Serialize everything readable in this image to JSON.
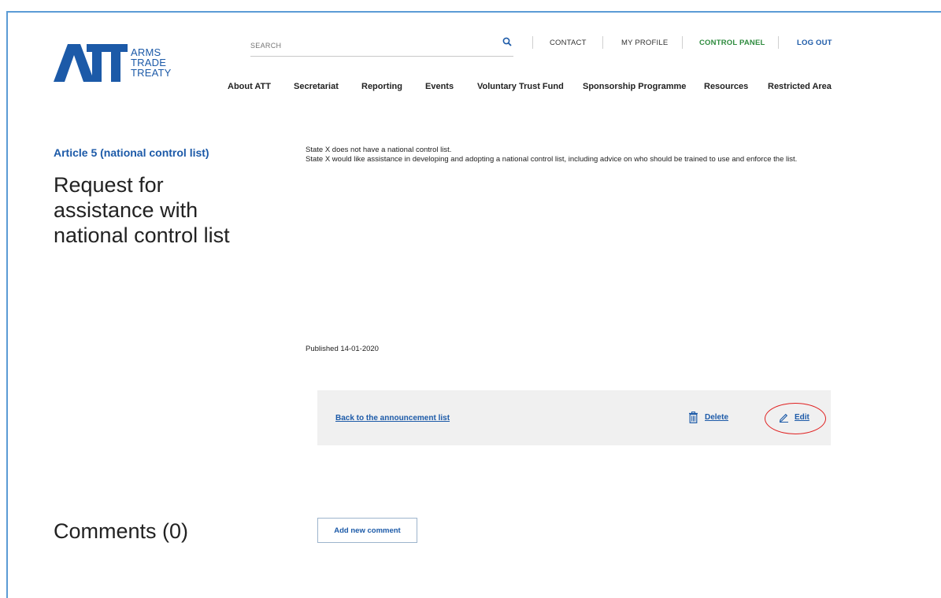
{
  "logo": {
    "mark": "ATT",
    "words": [
      "ARMS",
      "TRADE",
      "TREATY"
    ]
  },
  "search": {
    "placeholder": "SEARCH"
  },
  "utility_nav": {
    "contact": "CONTACT",
    "my_profile": "MY PROFILE",
    "control_panel": "CONTROL PANEL",
    "log_out": "LOG OUT"
  },
  "main_nav": [
    "About ATT",
    "Secretariat",
    "Reporting",
    "Events",
    "Voluntary Trust Fund",
    "Sponsorship Programme",
    "Resources",
    "Restricted Area"
  ],
  "announcement": {
    "category": "Article 5 (national control list)",
    "title": "Request for assistance with national control list",
    "body": [
      "State X does not have a national control list.",
      "State X would like assistance in developing and adopting a national control list, including advice on who should be trained to use and enforce the list."
    ],
    "published": "Published 14-01-2020"
  },
  "actions": {
    "back": "Back to the announcement list",
    "delete": "Delete",
    "edit": "Edit"
  },
  "comments": {
    "title": "Comments (0)",
    "add_button": "Add new comment"
  },
  "colors": {
    "brand_blue": "#1c5aa8",
    "control_green": "#2e8b3e",
    "highlight_red": "#e02020",
    "action_bar_bg": "#f0f0f0"
  },
  "icons": {
    "search": "search-icon",
    "delete": "trash-icon",
    "edit": "pencil-icon"
  }
}
